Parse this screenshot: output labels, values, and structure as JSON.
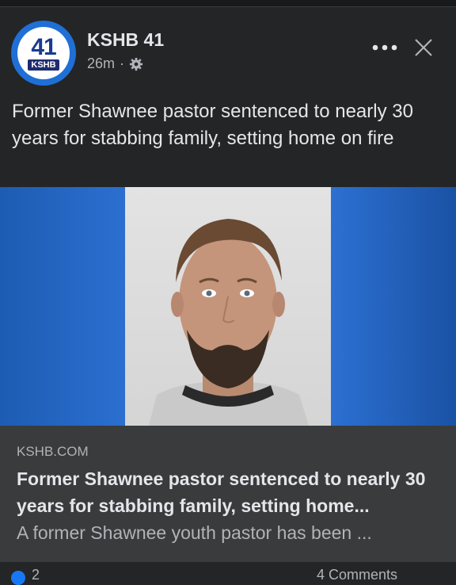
{
  "post": {
    "page_name": "KSHB 41",
    "avatar_number": "41",
    "avatar_callsign": "KSHB",
    "time": "26m",
    "separator": "·",
    "caption": "Former Shawnee pastor sentenced to nearly 30 years for stabbing family, setting home on fire"
  },
  "link_preview": {
    "domain": "KSHB.COM",
    "title": "Former Shawnee pastor sentenced to nearly 30 years for stabbing family, setting home...",
    "description": "A former Shawnee youth pastor has been ..."
  },
  "footer": {
    "reaction_count": "2",
    "comment_count": "4 Comments"
  },
  "icons": {
    "more": "more-options-icon",
    "close": "close-icon",
    "audience": "gear-icon",
    "like": "like-icon"
  },
  "colors": {
    "background": "#242526",
    "preview_bg": "#3a3b3c",
    "brand_blue": "#1f6fd6",
    "text_primary": "#e4e6eb",
    "text_secondary": "#b0b3b8"
  }
}
